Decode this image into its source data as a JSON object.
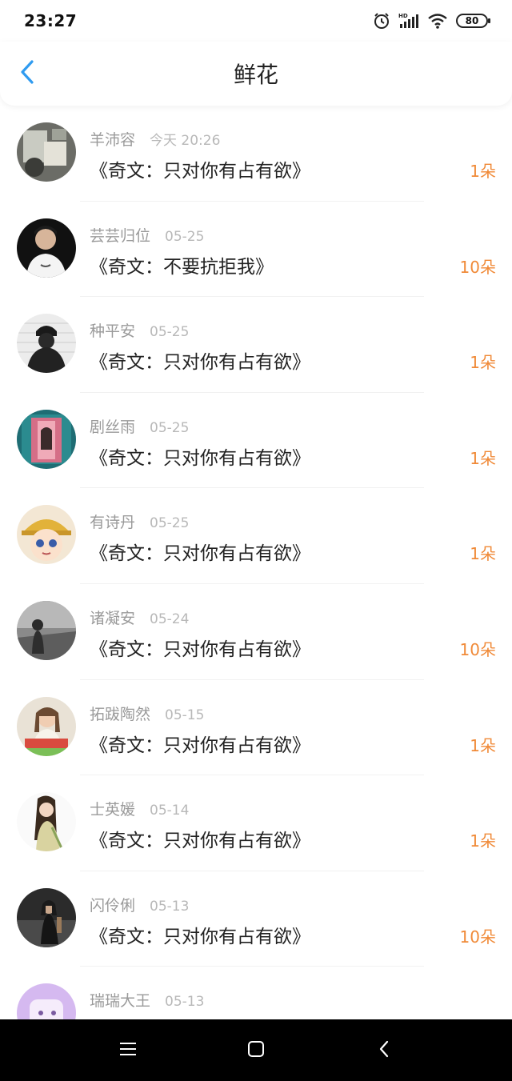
{
  "status_bar": {
    "time": "23:27",
    "battery": "80"
  },
  "header": {
    "title": "鲜花"
  },
  "colors": {
    "accent": "#2f9bf0",
    "flower_count": "#f08a38",
    "meta": "#9a9a9a"
  },
  "icons": {
    "back": "chevron-left-icon",
    "alarm": "alarm-icon",
    "signal": "signal-icon",
    "wifi": "wifi-icon",
    "battery": "battery-icon",
    "menu": "menu-icon",
    "home": "home-icon",
    "system_back": "back-triangle-icon"
  },
  "items": [
    {
      "name": "羊沛容",
      "time": "今天 20:26",
      "title": "《奇文：只对你有占有欲》",
      "count": "1朵"
    },
    {
      "name": "芸芸归位",
      "time": "05-25",
      "title": "《奇文：不要抗拒我》",
      "count": "10朵"
    },
    {
      "name": "种平安",
      "time": "05-25",
      "title": "《奇文：只对你有占有欲》",
      "count": "1朵"
    },
    {
      "name": "剧丝雨",
      "time": "05-25",
      "title": "《奇文：只对你有占有欲》",
      "count": "1朵"
    },
    {
      "name": "有诗丹",
      "time": "05-25",
      "title": "《奇文：只对你有占有欲》",
      "count": "1朵"
    },
    {
      "name": "诸凝安",
      "time": "05-24",
      "title": "《奇文：只对你有占有欲》",
      "count": "10朵"
    },
    {
      "name": "拓跋陶然",
      "time": "05-15",
      "title": "《奇文：只对你有占有欲》",
      "count": "1朵"
    },
    {
      "name": "士英媛",
      "time": "05-14",
      "title": "《奇文：只对你有占有欲》",
      "count": "1朵"
    },
    {
      "name": "闪伶俐",
      "time": "05-13",
      "title": "《奇文：只对你有占有欲》",
      "count": "10朵"
    },
    {
      "name": "瑞瑞大王",
      "time": "05-13",
      "title": "",
      "count": ""
    }
  ]
}
